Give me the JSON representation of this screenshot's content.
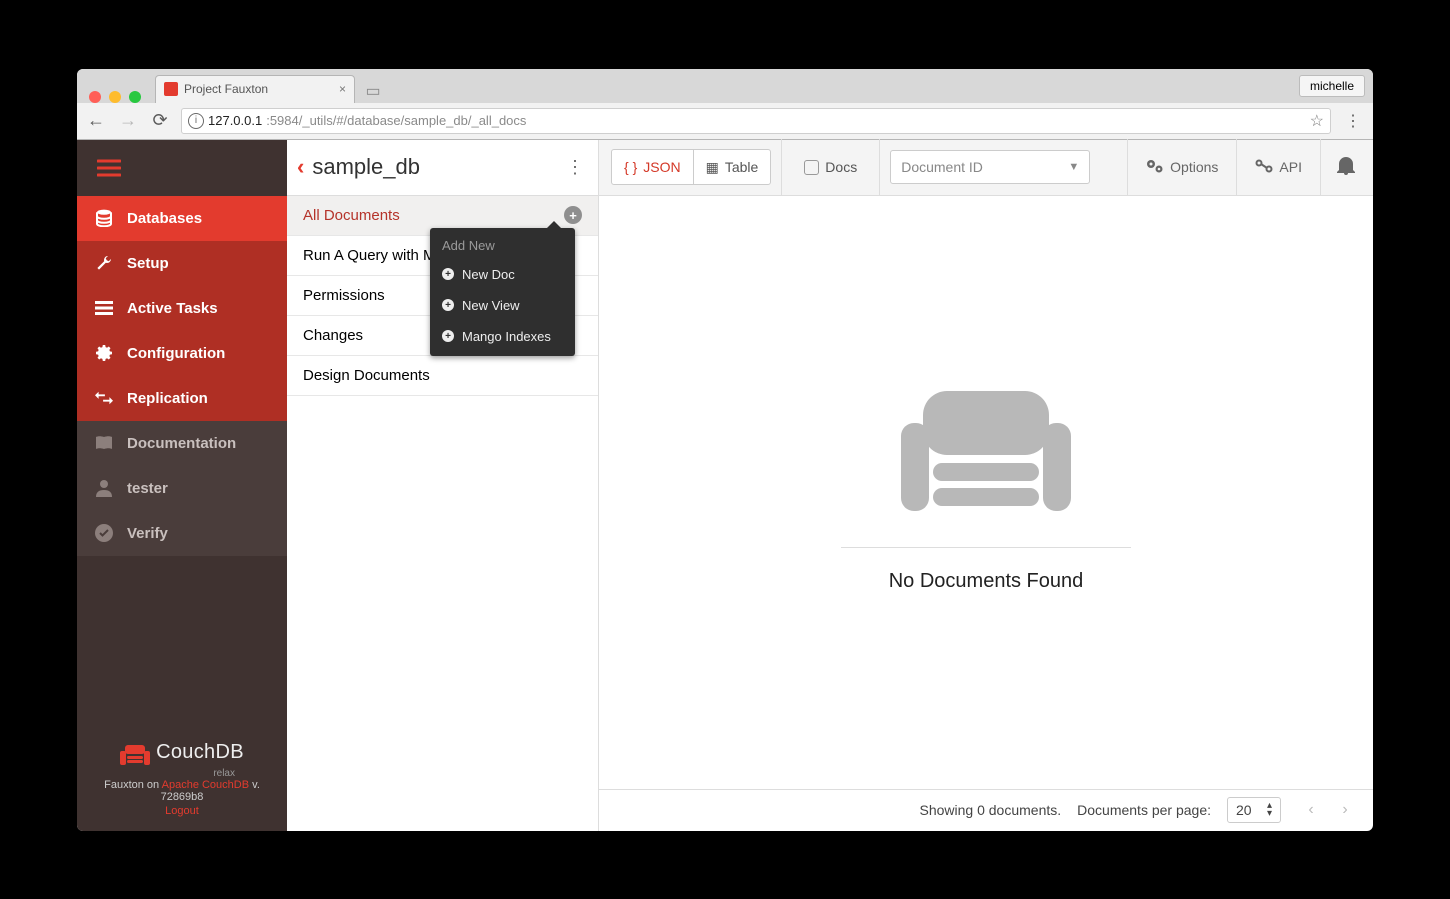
{
  "browser": {
    "tab_title": "Project Fauxton",
    "user": "michelle",
    "url_host": "127.0.0.1",
    "url_rest": ":5984/_utils/#/database/sample_db/_all_docs"
  },
  "sidebar": {
    "items": [
      {
        "label": "Databases"
      },
      {
        "label": "Setup"
      },
      {
        "label": "Active Tasks"
      },
      {
        "label": "Configuration"
      },
      {
        "label": "Replication"
      },
      {
        "label": "Documentation"
      },
      {
        "label": "tester"
      },
      {
        "label": "Verify"
      }
    ],
    "brand_name": "CouchDB",
    "brand_sub": "relax",
    "footer_pre": "Fauxton on ",
    "footer_link": "Apache CouchDB",
    "footer_ver": " v. 72869b8",
    "logout": "Logout"
  },
  "midcol": {
    "db_name": "sample_db",
    "rows": [
      {
        "label": "All Documents"
      },
      {
        "label": "Run A Query with Mango"
      },
      {
        "label": "Permissions"
      },
      {
        "label": "Changes"
      },
      {
        "label": "Design Documents"
      }
    ],
    "popover": {
      "title": "Add New",
      "items": [
        {
          "label": "New Doc"
        },
        {
          "label": "New View"
        },
        {
          "label": "Mango Indexes"
        }
      ]
    }
  },
  "toolbar": {
    "json": "JSON",
    "table": "Table",
    "docs": "Docs",
    "docid": "Document ID",
    "options": "Options",
    "api": "API"
  },
  "content": {
    "empty": "No Documents Found"
  },
  "footer": {
    "showing": "Showing 0 documents.",
    "perpage_label": "Documents per page:",
    "perpage_value": "20"
  }
}
